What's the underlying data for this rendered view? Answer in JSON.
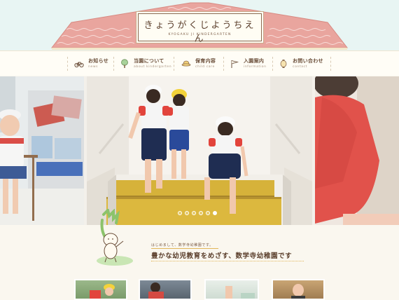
{
  "header": {
    "title": "きょうがくじようちえん",
    "subtitle": "KYOGAKU JI KINDERGARTEN"
  },
  "nav": {
    "items": [
      {
        "jp": "お知らせ",
        "en": "news",
        "icon": "bicycle-icon"
      },
      {
        "jp": "当園について",
        "en": "about kindergarten",
        "icon": "tree-icon"
      },
      {
        "jp": "保育内容",
        "en": "child care",
        "icon": "hat-icon"
      },
      {
        "jp": "入園案内",
        "en": "information",
        "icon": "flag-icon"
      },
      {
        "jp": "お問い合わせ",
        "en": "contact",
        "icon": "lantern-icon"
      }
    ]
  },
  "slider": {
    "dot_count": 6,
    "active_dot": 6
  },
  "intro": {
    "greeting": "はじめまして、数学寺幼稚園です。",
    "headline": "豊かな幼児教育をめざす、数学寺幼稚園です"
  },
  "colors": {
    "roof": "#e8a29a",
    "accent_gold": "#e2b65a",
    "text_brown": "#5b3f2c",
    "sky": "#e8f5f3"
  }
}
